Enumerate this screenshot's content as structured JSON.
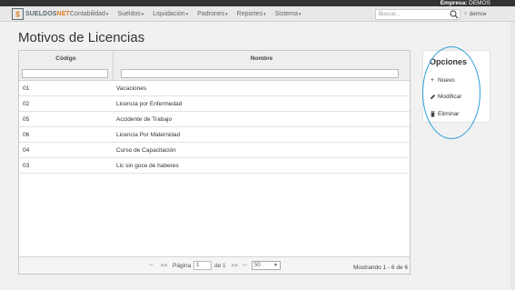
{
  "topbar": {
    "empresa_label": "Empresa:",
    "empresa_value": "DEMOS"
  },
  "brand": {
    "name_a": "SUELDOS",
    "name_b": "NET"
  },
  "menu": [
    {
      "label": "Contabilidad"
    },
    {
      "label": "Sueldos"
    },
    {
      "label": "Liquidación"
    },
    {
      "label": "Padrones"
    },
    {
      "label": "Reportes"
    },
    {
      "label": "Sistema"
    }
  ],
  "search": {
    "placeholder": "Buscar..."
  },
  "user": {
    "name": "demo"
  },
  "page": {
    "title": "Motivos de Licencias"
  },
  "grid": {
    "columns": [
      "Código",
      "Nombre"
    ],
    "rows": [
      {
        "codigo": "01",
        "nombre": "Vacaciones"
      },
      {
        "codigo": "02",
        "nombre": "Licencia por Enfermedad"
      },
      {
        "codigo": "05",
        "nombre": "Accidente de Trabajo"
      },
      {
        "codigo": "06",
        "nombre": "Licencia Por Maternidad"
      },
      {
        "codigo": "04",
        "nombre": "Curso de Capacitación"
      },
      {
        "codigo": "03",
        "nombre": "Lic sin goce de haberes"
      }
    ]
  },
  "pager": {
    "page_label": "Página",
    "page_value": "1",
    "of_label": "de 1",
    "page_size": "50",
    "info": "Mostrando 1 - 6 de 6"
  },
  "options": {
    "title": "Opciones",
    "items": [
      {
        "label": "Nuevo",
        "icon": "plus-icon"
      },
      {
        "label": "Modificar",
        "icon": "pencil-icon"
      },
      {
        "label": "Eliminar",
        "icon": "trash-icon"
      }
    ]
  },
  "colors": {
    "accent_orange": "#e27d1e",
    "highlight_blue": "#2a9fd6",
    "topbar": "#333333"
  }
}
